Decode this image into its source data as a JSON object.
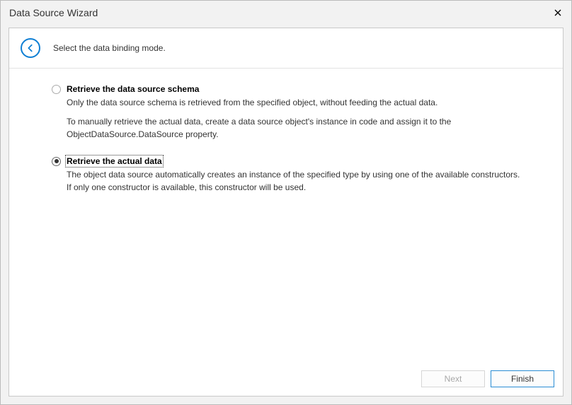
{
  "window": {
    "title": "Data Source Wizard"
  },
  "header": {
    "subtitle": "Select the data binding mode."
  },
  "options": {
    "schema": {
      "title": "Retrieve the data source schema",
      "desc1": "Only the data source schema is retrieved from the specified object, without feeding the actual data.",
      "desc2": "To manually retrieve the actual data, create a data source object's instance in code and assign it to the ObjectDataSource.DataSource property.",
      "selected": false
    },
    "actual": {
      "title": "Retrieve the actual data",
      "desc1": "The object data source automatically creates an instance of the specified type by using one of the available constructors. If only one constructor is available, this constructor will be used.",
      "selected": true
    }
  },
  "footer": {
    "next": "Next",
    "finish": "Finish"
  }
}
